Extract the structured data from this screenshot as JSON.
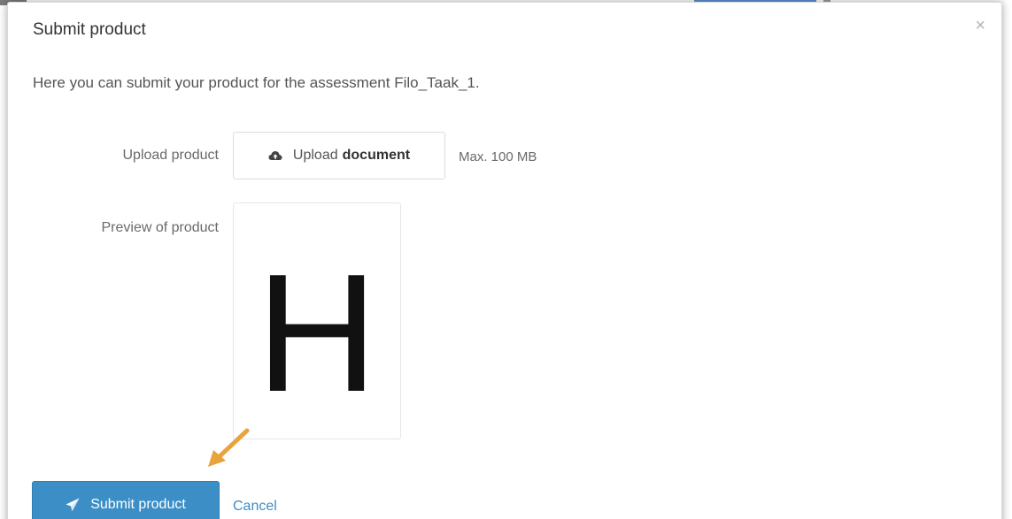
{
  "dialog": {
    "title": "Submit product",
    "close_symbol": "×",
    "intro": "Here you can submit your product for the assessment Filo_Taak_1."
  },
  "upload": {
    "label": "Upload product",
    "button_prefix": "Upload",
    "button_bold": "document",
    "icon": "cloud-upload-icon",
    "max_size": "Max. 100 MB"
  },
  "preview": {
    "label": "Preview of product",
    "letter": "H"
  },
  "annotation": {
    "arrow_color": "#e8a33d"
  },
  "actions": {
    "submit_label": "Submit product",
    "submit_icon": "paper-plane-icon",
    "cancel_label": "Cancel"
  },
  "colors": {
    "primary": "#3c8fc6"
  }
}
